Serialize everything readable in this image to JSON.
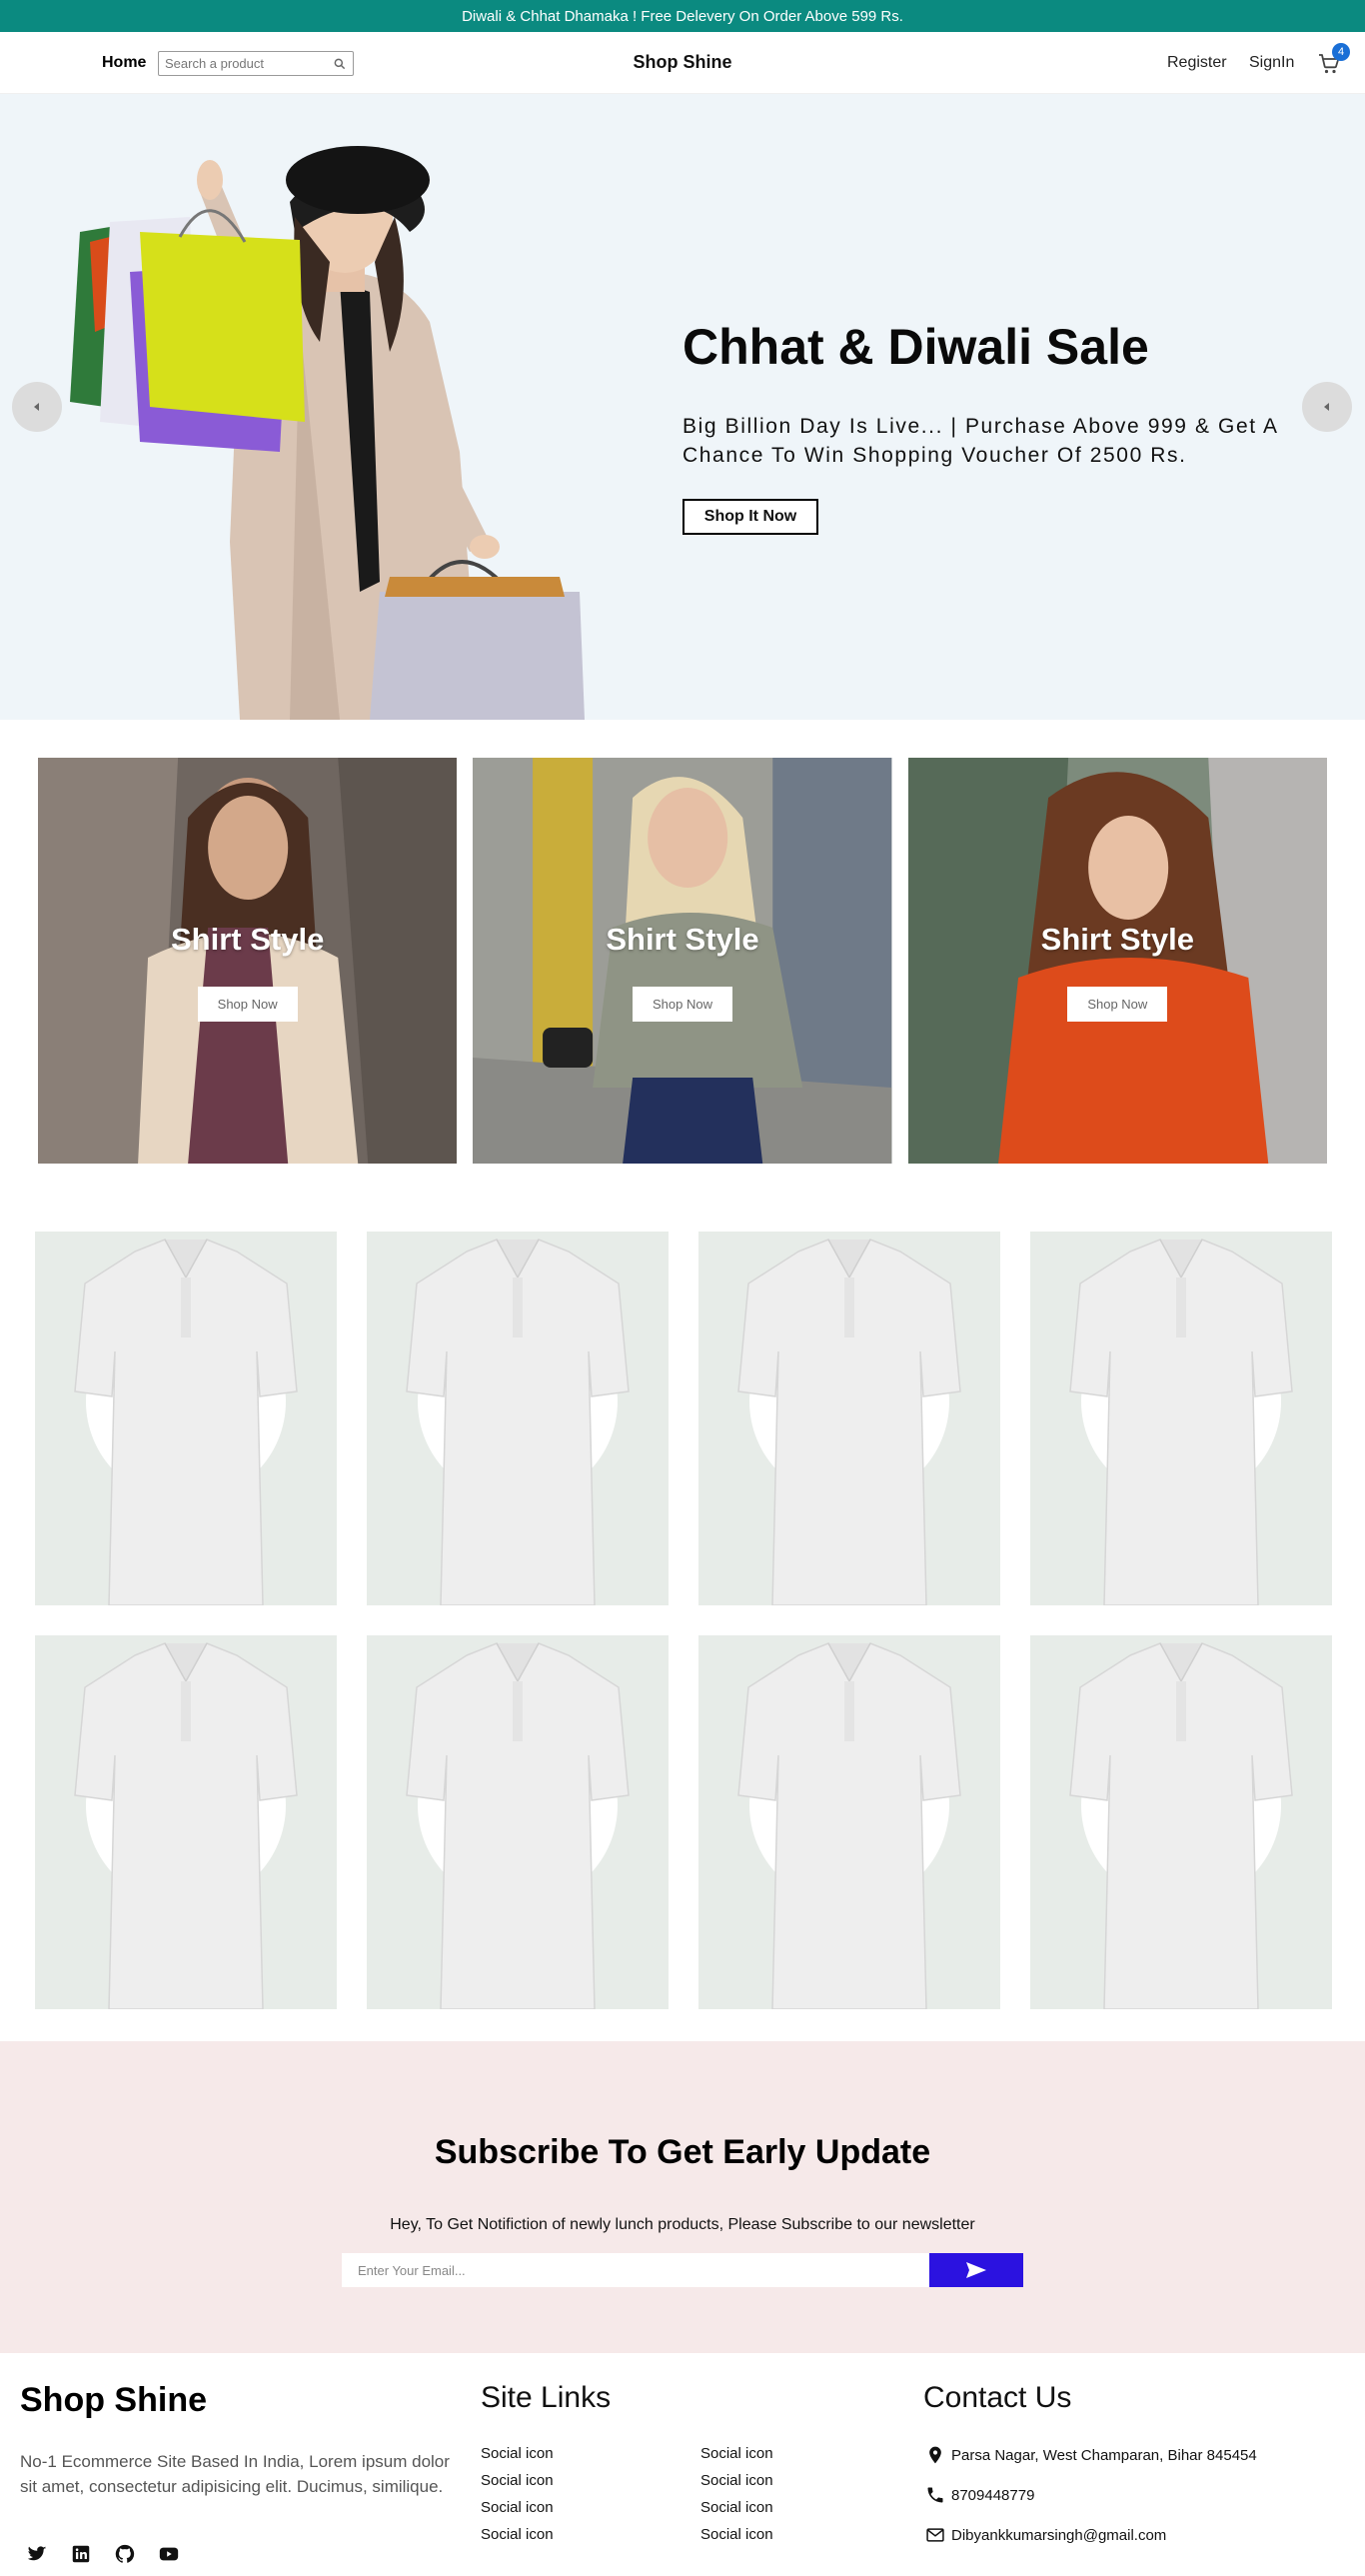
{
  "announcement": "Diwali & Chhat Dhamaka ! Free Delevery On Order Above 599 Rs.",
  "nav": {
    "home": "Home",
    "search_placeholder": "Search a product",
    "brand": "Shop Shine",
    "register": "Register",
    "signin": "SignIn",
    "cart_count": "4"
  },
  "hero": {
    "title": "Chhat & Diwali Sale",
    "subtitle": "Big Billion Day Is Live... | Purchase Above 999 & Get A Chance To Win Shopping Voucher Of 2500 Rs.",
    "button": "Shop It Now"
  },
  "categories": [
    {
      "title": "Shirt Style",
      "button": "Shop Now"
    },
    {
      "title": "Shirt Style",
      "button": "Shop Now"
    },
    {
      "title": "Shirt Style",
      "button": "Shop Now"
    }
  ],
  "subscribe": {
    "title": "Subscribe To Get Early Update",
    "text": "Hey, To Get Notifiction of newly lunch products, Please Subscribe to our newsletter",
    "placeholder": "Enter Your Email..."
  },
  "footer": {
    "brand": "Shop Shine",
    "description": "No-1 Ecommerce Site Based In India, Lorem ipsum dolor sit amet, consectetur adipisicing elit. Ducimus, similique.",
    "links_title": "Site Links",
    "links": [
      "Social icon",
      "Social icon",
      "Social icon",
      "Social icon",
      "Social icon",
      "Social icon",
      "Social icon",
      "Social icon"
    ],
    "contact_title": "Contact Us",
    "address": "Parsa Nagar, West Champaran, Bihar 845454",
    "phone": "8709448779",
    "email": "Dibyankkumarsingh@gmail.com",
    "social_icons": [
      "twitter-icon",
      "linkedin-icon",
      "github-icon",
      "youtube-icon"
    ]
  },
  "colors": {
    "topbar": "#0b8a80",
    "hero_bg": "#eff5f9",
    "subscribe_bg": "#f6e9e9",
    "send_button": "#2b12e0",
    "badge": "#1a6fd6"
  }
}
